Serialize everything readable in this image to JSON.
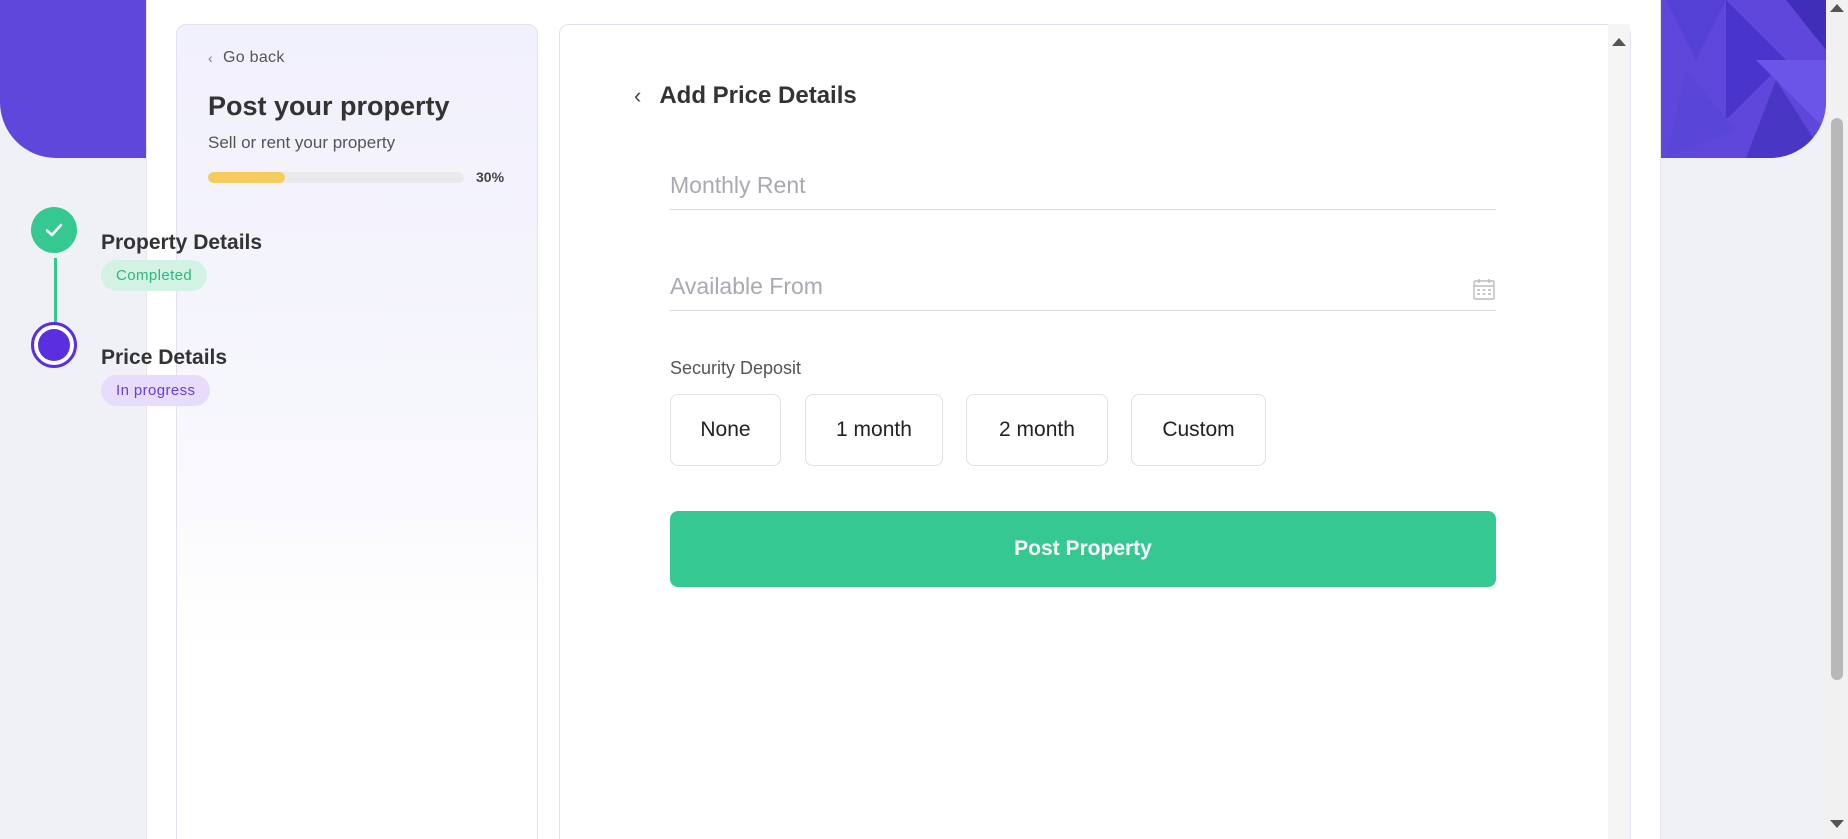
{
  "sidebar": {
    "go_back": "Go back",
    "title": "Post your property",
    "subtitle": "Sell or rent your property",
    "progress": {
      "value": 0.3,
      "label": "30%"
    },
    "steps": [
      {
        "label": "Property Details",
        "status": "Completed",
        "icon": "check-icon"
      },
      {
        "label": "Price Details",
        "status": "In progress",
        "icon": "active-step-icon"
      }
    ]
  },
  "main": {
    "title": "Add Price Details",
    "fields": {
      "monthly_rent": {
        "placeholder": "Monthly Rent",
        "value": ""
      },
      "available_from": {
        "placeholder": "Available From",
        "value": "",
        "icon": "calendar-icon"
      }
    },
    "security_deposit": {
      "label": "Security Deposit",
      "options": [
        "None",
        "1 month",
        "2 month",
        "Custom"
      ]
    },
    "submit_label": "Post Property"
  },
  "colors": {
    "brand_purple": "#5f47dc",
    "accent_green": "#35c891",
    "progress_yellow": "#f7cc5e",
    "active_purple": "#5a2fe0"
  }
}
